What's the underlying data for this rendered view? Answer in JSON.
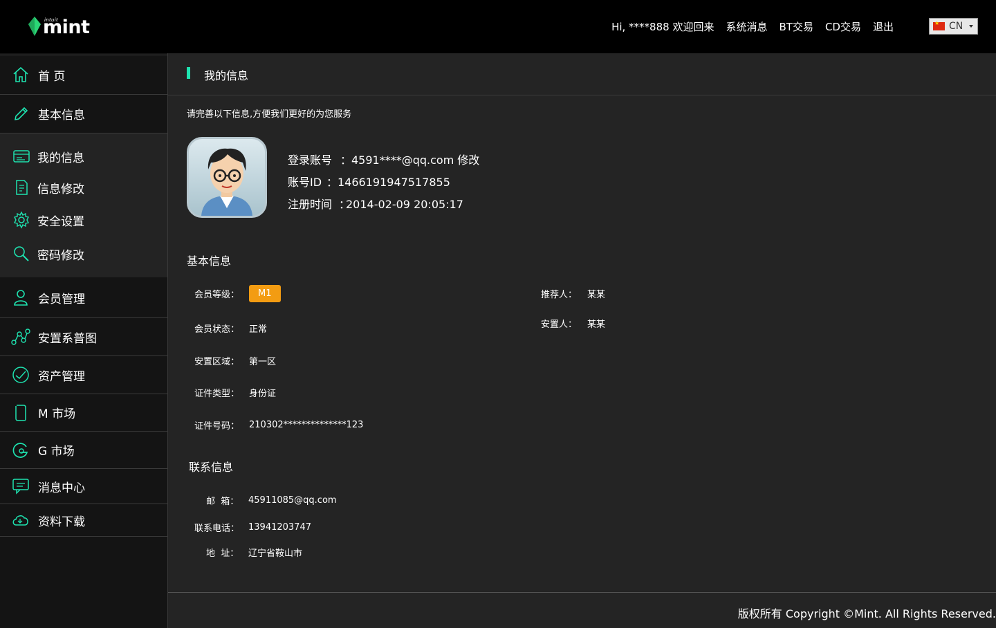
{
  "brand": {
    "small": "intuit",
    "name": "mint"
  },
  "topnav": {
    "greeting": "Hi, ****888 欢迎回来",
    "messages": "系统消息",
    "bt_trade": "BT交易",
    "cd_trade": "CD交易",
    "logout": "退出",
    "lang": "CN"
  },
  "sidebar": {
    "home": "首 页",
    "basic_info": "基本信息",
    "sub": {
      "my_info": "我的信息",
      "edit_info": "信息修改",
      "security": "安全设置",
      "password": "密码修改"
    },
    "member": "会员管理",
    "placement_map": "安置系普图",
    "assets": "资产管理",
    "m_market": "M 市场",
    "g_market": "G 市场",
    "message_center": "消息中心",
    "downloads": "资料下载"
  },
  "page": {
    "title": "我的信息",
    "notice": "请完善以下信息,方便我们更好的为您服务"
  },
  "account": {
    "login_label": "登录账号",
    "login_value": "4591****@qq.com",
    "edit": "修改",
    "id_label": "账号ID",
    "id_value": "1466191947517855",
    "reg_label": "注册时间",
    "reg_value": "2014-02-09 20:05:17",
    "sep": "："
  },
  "basic": {
    "title": "基本信息",
    "level_label": "会员等级：",
    "level_value": "M1",
    "status_label": "会员状态：",
    "status_value": "正常",
    "area_label": "安置区域：",
    "area_value": "第一区",
    "idtype_label": "证件类型：",
    "idtype_value": "身份证",
    "idno_label": "证件号码：",
    "idno_value": "210302**************123",
    "referrer_label": "推荐人：",
    "referrer_value": "某某",
    "placer_label": "安置人：",
    "placer_value": "某某"
  },
  "contact": {
    "title": "联系信息",
    "email_label": "邮  箱：",
    "email_value": "45911085@qq.com",
    "phone_label": "联系电话：",
    "phone_value": "13941203747",
    "address_label": "地  址：",
    "address_value": "辽宁省鞍山市"
  },
  "footer": {
    "copyright": "版权所有 Copyright ©Mint. All Rights Reserved."
  },
  "colors": {
    "accent": "#1ee3b0",
    "badge": "#f39c12",
    "sidebar_bg": "#141414",
    "main_bg": "#242424"
  }
}
